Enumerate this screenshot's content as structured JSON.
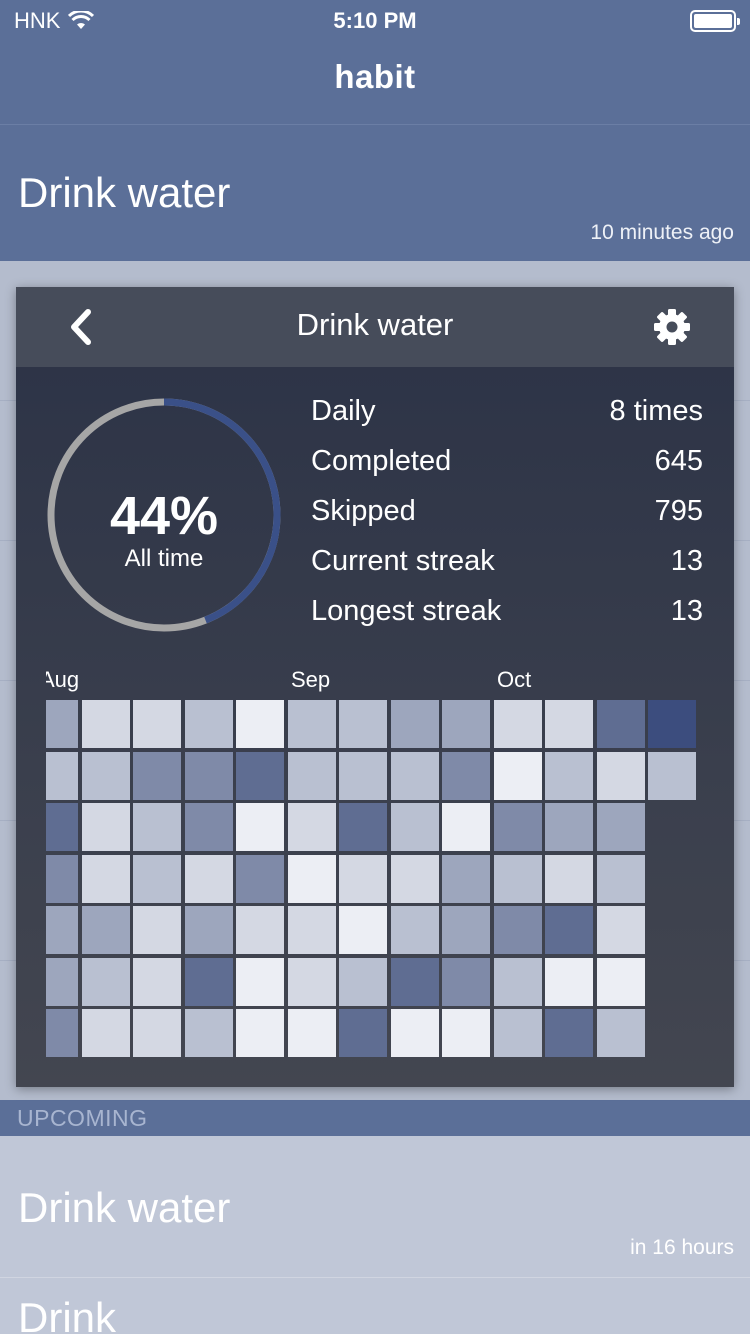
{
  "status_bar": {
    "carrier": "HNK",
    "time": "5:10 PM"
  },
  "app": {
    "title": "habit"
  },
  "current_habit": {
    "title": "Drink water",
    "subtitle": "10 minutes ago"
  },
  "modal": {
    "title": "Drink water",
    "percent": "44%",
    "percent_label": "All time",
    "progress_fraction": 0.44,
    "stats": [
      {
        "label": "Daily",
        "value": "8 times"
      },
      {
        "label": "Completed",
        "value": "645"
      },
      {
        "label": "Skipped",
        "value": "795"
      },
      {
        "label": "Current streak",
        "value": "13"
      },
      {
        "label": "Longest streak",
        "value": "13"
      }
    ],
    "months": [
      "Aug",
      "Sep",
      "Oct"
    ],
    "heatmap_levels": [
      [
        3,
        2,
        5,
        4,
        3,
        3,
        4
      ],
      [
        1,
        2,
        1,
        1,
        3,
        2,
        1
      ],
      [
        1,
        4,
        2,
        2,
        1,
        1,
        1
      ],
      [
        2,
        4,
        4,
        1,
        3,
        5,
        2
      ],
      [
        0,
        5,
        0,
        4,
        1,
        0,
        0
      ],
      [
        2,
        2,
        1,
        0,
        1,
        1,
        0
      ],
      [
        2,
        2,
        5,
        1,
        0,
        2,
        5
      ],
      [
        3,
        2,
        2,
        1,
        2,
        5,
        0
      ],
      [
        3,
        4,
        0,
        3,
        3,
        4,
        0
      ],
      [
        1,
        0,
        4,
        2,
        4,
        2,
        2
      ],
      [
        1,
        2,
        3,
        1,
        5,
        0,
        5
      ],
      [
        5,
        1,
        3,
        2,
        1,
        0,
        2
      ],
      [
        6,
        2
      ]
    ],
    "heatmap_colors": [
      "#eceef4",
      "#d4d8e3",
      "#b9c0d1",
      "#9da6bd",
      "#7f8aa8",
      "#5f6d92",
      "#3c4d7e"
    ]
  },
  "upcoming": {
    "section_label": "UPCOMING",
    "item": {
      "title": "Drink water",
      "subtitle": "in 16 hours"
    },
    "next_title": "Drink"
  },
  "colors": {
    "nav": "#5b6f98",
    "ring_track": "#a6a6a6",
    "ring_fill": "#3a5088"
  }
}
